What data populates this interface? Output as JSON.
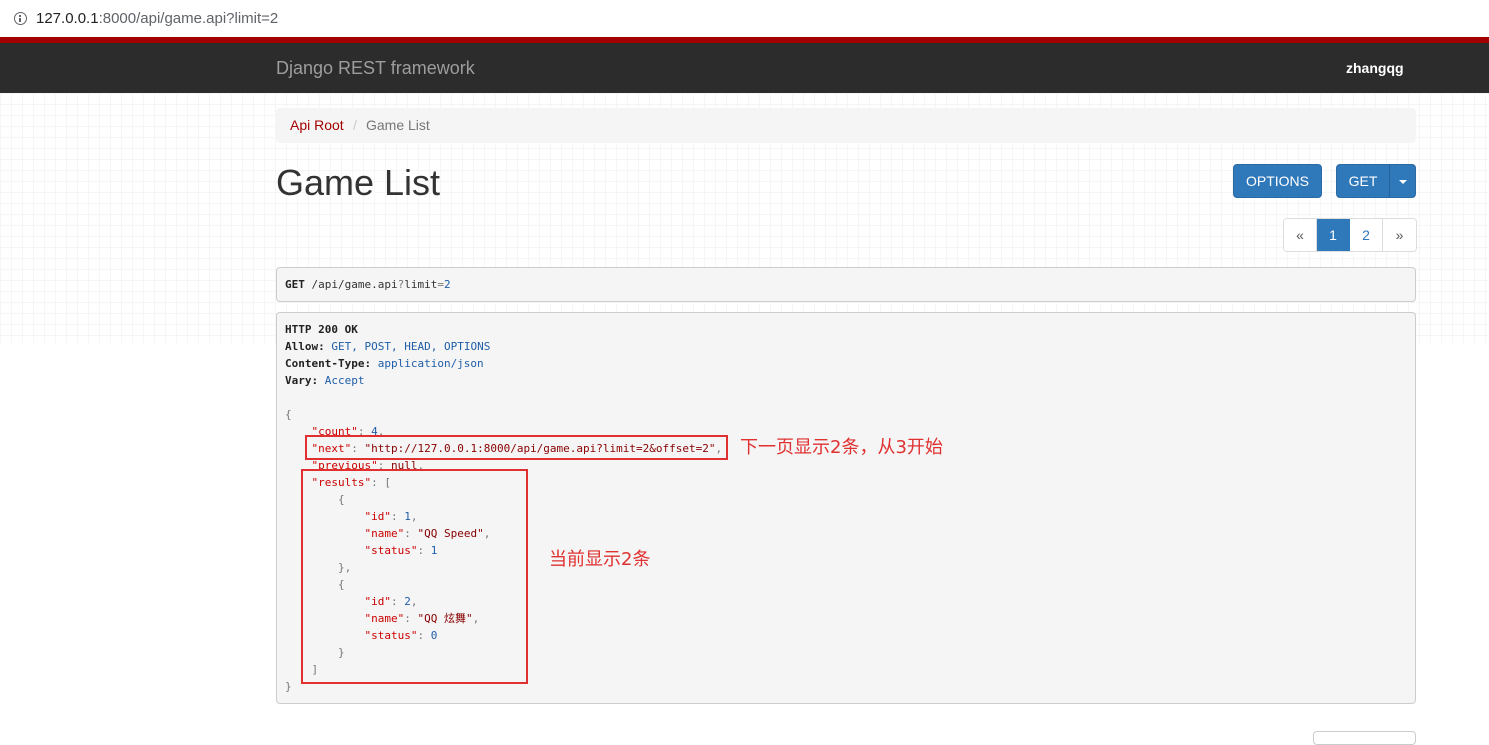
{
  "browser": {
    "url_host": "127.0.0.1",
    "url_rest": ":8000/api/game.api?limit=2"
  },
  "navbar": {
    "brand": "Django REST framework",
    "user": "zhangqg"
  },
  "breadcrumb": {
    "root": "Api Root",
    "separator": "/",
    "current": "Game List"
  },
  "page": {
    "title": "Game List",
    "options_label": "OPTIONS",
    "get_label": "GET"
  },
  "pagination": {
    "prev": "«",
    "pages": [
      "1",
      "2"
    ],
    "next": "»",
    "current_page": 1
  },
  "request": {
    "method": "GET",
    "path": " /api/game.api",
    "query_sep": "?",
    "query": "limit",
    "eq": "=",
    "value": "2"
  },
  "response": {
    "status_line": "HTTP 200 OK",
    "allow_label": "Allow:",
    "allow_value": " GET, POST, HEAD, OPTIONS",
    "content_type_label": "Content-Type:",
    "content_type_value": " application/json",
    "vary_label": "Vary:",
    "vary_value": " Accept",
    "count_key": "\"count\"",
    "count_value": "4",
    "next_key": "\"next\"",
    "next_value": "\"http://127.0.0.1:8000/api/game.api?limit=2&offset=2\"",
    "previous_key": "\"previous\"",
    "previous_value": "null",
    "results_key": "\"results\"",
    "results": [
      {
        "id": "1",
        "name": "\"QQ Speed\"",
        "status": "1"
      },
      {
        "id": "2",
        "name": "\"QQ 炫舞\"",
        "status": "0"
      }
    ]
  },
  "annotations": {
    "next_note": "下一页显示2条，从3开始",
    "results_note": "当前显示2条"
  }
}
